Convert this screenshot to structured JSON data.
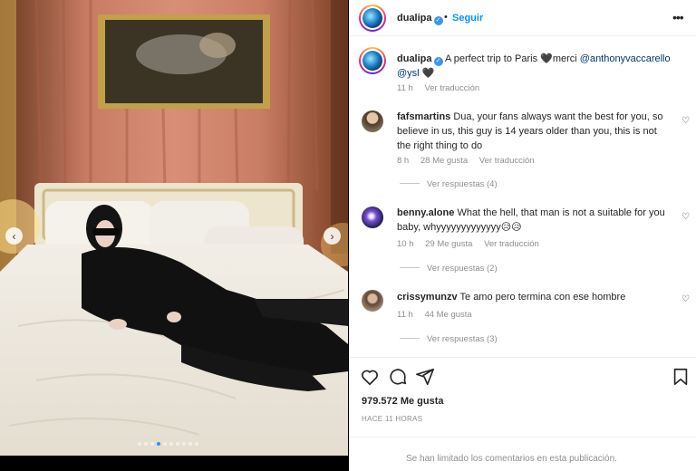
{
  "post": {
    "username": "dualipa",
    "follow_label": "Seguir",
    "separator": "•",
    "more_icon": "more-horizontal-icon",
    "caption_text": "A perfect trip to Paris 🖤merci",
    "mention_1": "@anthonyvaccarello",
    "mention_2": "@ysl",
    "caption_end": "🖤",
    "caption_time": "11 h",
    "translate_label": "Ver traducción",
    "likes": "979.572 Me gusta",
    "time_ago": "HACE 11 HORAS",
    "comments_limited": "Se han limitado los comentarios en esta publicación.",
    "carousel": {
      "total_slides": 10,
      "active_slide": 4
    }
  },
  "comments": [
    {
      "username": "fafsmartins",
      "text": "Dua, your fans always want the best for you, so believe in us, this guy is 14 years older than you, this is not the right thing to do",
      "time": "8 h",
      "likes": "28 Me gusta",
      "translate": "Ver traducción",
      "replies": "Ver respuestas (4)"
    },
    {
      "username": "benny.alone",
      "text": "What the hell, that man is not a suitable for you baby, whyyyyyyyyyyyyy😥😥",
      "time": "10 h",
      "likes": "29 Me gusta",
      "translate": "Ver traducción",
      "replies": "Ver respuestas (2)"
    },
    {
      "username": "crissymunzv",
      "text": "Te amo pero termina con ese hombre",
      "time": "11 h",
      "likes": "44 Me gusta",
      "replies": "Ver respuestas (3)"
    }
  ],
  "colors": {
    "link": "#0095f6",
    "mention": "#00376b",
    "muted": "#8e8e8e",
    "verified": "#3897f0",
    "carousel_dot_active": "#3a8ee6"
  }
}
